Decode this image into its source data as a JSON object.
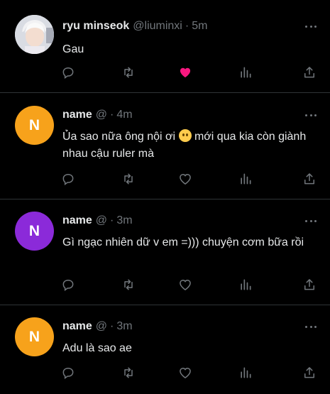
{
  "tweets": [
    {
      "name": "ryu minseok",
      "handle": "@liuminxi",
      "sep": "·",
      "time": "5m",
      "text": "Gau",
      "avatar_type": "photo",
      "liked": true
    },
    {
      "name": "name",
      "handle": "@",
      "sep": "·",
      "time": "4m",
      "text_before": "Ủa sao nữa ông nội ơi ",
      "text_after": " mới qua kia còn giành nhau cậu ruler mà",
      "emoji": "slightly-smiling-face",
      "avatar_letter": "N",
      "avatar_color": "#f7a21b",
      "liked": false
    },
    {
      "name": "name",
      "handle": "@",
      "sep": "·",
      "time": "3m",
      "text": "Gì ngạc nhiên dữ v em =))) chuyện cơm bữa rồi",
      "avatar_letter": "N",
      "avatar_color": "#8b2ad9",
      "liked": false
    },
    {
      "name": "name",
      "handle": "@",
      "sep": "·",
      "time": "3m",
      "text": "Adu là sao ae",
      "avatar_letter": "N",
      "avatar_color": "#f7a21b",
      "liked": false
    }
  ],
  "colors": {
    "background": "#000000",
    "text": "#e7e9ea",
    "muted": "#71767b",
    "divider": "#2f3336",
    "like_active": "#f91880"
  },
  "icons": [
    "reply-icon",
    "retweet-icon",
    "like-icon",
    "views-icon",
    "share-icon",
    "more-icon"
  ]
}
